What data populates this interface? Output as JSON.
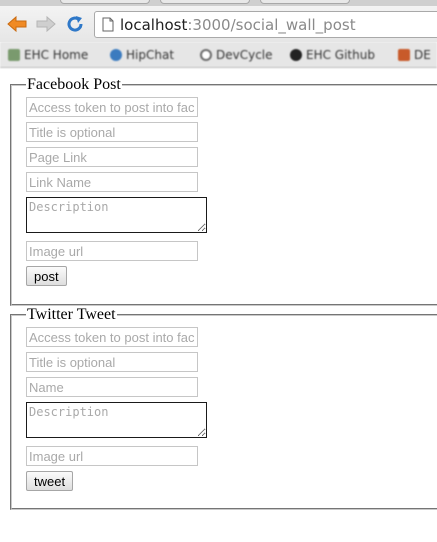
{
  "browser": {
    "url_host": "localhost",
    "url_path": ":3000/social_wall_post",
    "bookmarks": [
      {
        "label": "EHC Home",
        "color": "#7a9a6e"
      },
      {
        "label": "HipChat",
        "color": "#3b7bbf"
      },
      {
        "label": "DevCycle",
        "color": "#6a6a6a"
      },
      {
        "label": "EHC Github",
        "color": "#222222"
      },
      {
        "label": "DE",
        "color": "#c85a2a"
      }
    ]
  },
  "facebook": {
    "legend": "Facebook Post",
    "access_token_placeholder": "Access token to post into fac",
    "title_placeholder": "Title is optional",
    "page_link_placeholder": "Page Link",
    "link_name_placeholder": "Link Name",
    "description_placeholder": "Description",
    "image_url_placeholder": "Image url",
    "submit_label": "post"
  },
  "twitter": {
    "legend": "Twitter Tweet",
    "access_token_placeholder": "Access token to post into fac",
    "title_placeholder": "Title is optional",
    "name_placeholder": "Name",
    "description_placeholder": "Description",
    "image_url_placeholder": "Image url",
    "submit_label": "tweet"
  }
}
